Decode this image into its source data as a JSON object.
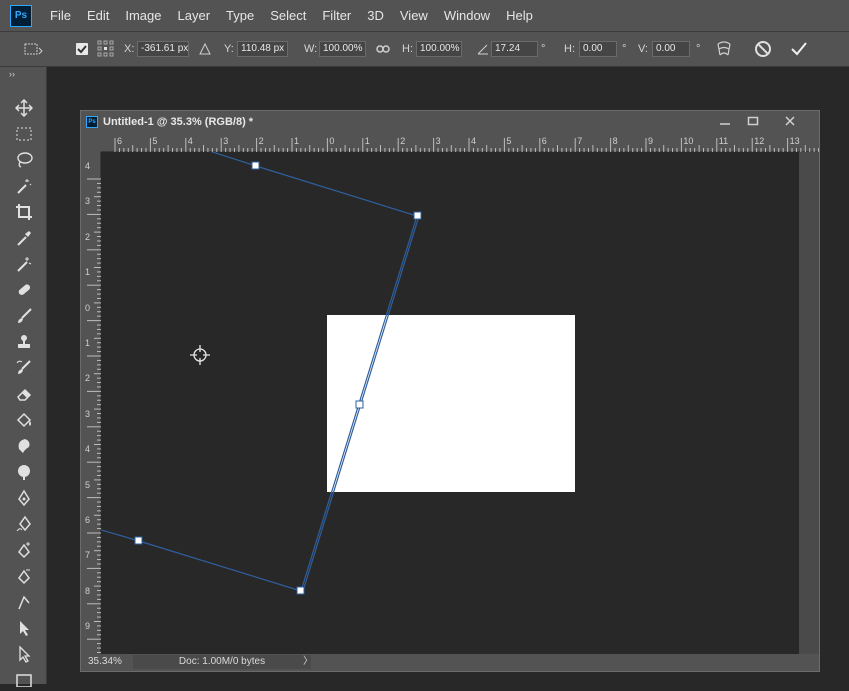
{
  "app": {
    "logo_text": "Ps"
  },
  "menu": [
    "File",
    "Edit",
    "Image",
    "Layer",
    "Type",
    "Select",
    "Filter",
    "3D",
    "View",
    "Window",
    "Help"
  ],
  "options": {
    "x_label": "X:",
    "x_value": "-361.61 px",
    "y_label": "Y:",
    "y_value": "110.48 px",
    "w_label": "W:",
    "w_value": "100.00%",
    "h_label": "H:",
    "h_value": "100.00%",
    "angle_value": "17.24",
    "angle_unit": "°",
    "hskew_label": "H:",
    "hskew_value": "0.00",
    "hskew_unit": "°",
    "vskew_label": "V:",
    "vskew_value": "0.00",
    "vskew_unit": "°"
  },
  "toolbar": {
    "collapse_label": "››"
  },
  "document": {
    "title": "Untitled-1 @ 35.3% (RGB/8) *",
    "icon_text": "Ps",
    "ruler_top_labels": [
      "6",
      "5",
      "4",
      "3",
      "2",
      "1",
      "0",
      "1",
      "2",
      "3",
      "4",
      "5",
      "6",
      "7",
      "8",
      "9",
      "10",
      "11",
      "12",
      "13"
    ],
    "ruler_left_labels": [
      "4",
      "3",
      "2",
      "1",
      "0",
      "1",
      "2",
      "3",
      "4",
      "5",
      "6",
      "7",
      "8",
      "9"
    ],
    "zoom": "35.34%",
    "doc_info": "Doc: 1.00M/0 bytes",
    "status_arrow": "〉"
  },
  "colors": {
    "path": "#2f5f9e",
    "canvas_bg": "#282828",
    "ui_bg": "#535353",
    "accent": "#31a8ff"
  }
}
